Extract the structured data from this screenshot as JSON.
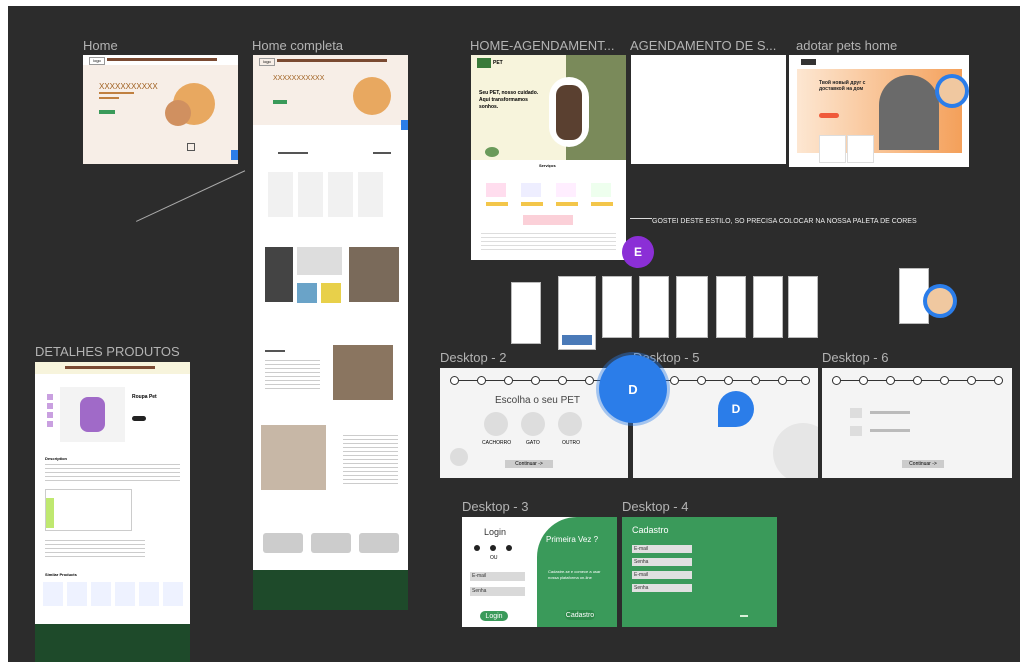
{
  "colors": {
    "canvas": "#2c2c2c",
    "label": "#b3b3b3",
    "green": "#3a9a5a",
    "avatar_blue": "#2b7de9",
    "avatar_purple": "#8b2fd6"
  },
  "frames": {
    "home": {
      "label": "Home",
      "placeholder": "XXXXXXXXXXX",
      "logo": "logo"
    },
    "home_completa": {
      "label": "Home completa",
      "placeholder": "XXXXXXXXXXX",
      "logo": "logo"
    },
    "home_agendamento": {
      "label": "HOME-AGENDAMENT...",
      "brand": "PET",
      "headline": "Seu PET, nosso cuidado. Aqui transformamos sonhos.",
      "section": "Serviços"
    },
    "agendamento_s": {
      "label": "AGENDAMENTO DE S..."
    },
    "adotar_pets": {
      "label": "adotar pets home",
      "headline": "Твой новый друг с доставкой на дом"
    },
    "detalhes": {
      "label": "DETALHES PRODUTOS",
      "product_title": "Roupa Pet",
      "section_description": "Description",
      "section_similar": "Similar Products"
    },
    "desktop2": {
      "label": "Desktop - 2",
      "title": "Escolha o seu PET",
      "options": [
        "CACHORRO",
        "GATO",
        "OUTRO"
      ],
      "continue": "Continuar ->"
    },
    "desktop5": {
      "label": "Desktop - 5"
    },
    "desktop6": {
      "label": "Desktop - 6",
      "continue": "Continuar ->"
    },
    "desktop3": {
      "label": "Desktop - 3",
      "login_title": "Login",
      "ou": "OU",
      "email": "E-mail",
      "senha": "Senha",
      "login_button": "Login",
      "first_time": "Primeira Vez ?",
      "first_time_text": "Cadastre-se e comece a usar nossa plataforma on-line",
      "cadastro_button": "Cadastro"
    },
    "desktop4": {
      "label": "Desktop - 4",
      "title": "Cadastro",
      "fields": [
        "E-mail",
        "Senha",
        "E-mail",
        "Senha"
      ]
    }
  },
  "comment": {
    "text": "GOSTEI DESTE ESTILO, SO PRECISA COLOCAR NA NOSSA PALETA DE CORES",
    "author_initial": "E"
  },
  "collaborators": {
    "d_big": "D",
    "d_small": "D"
  }
}
